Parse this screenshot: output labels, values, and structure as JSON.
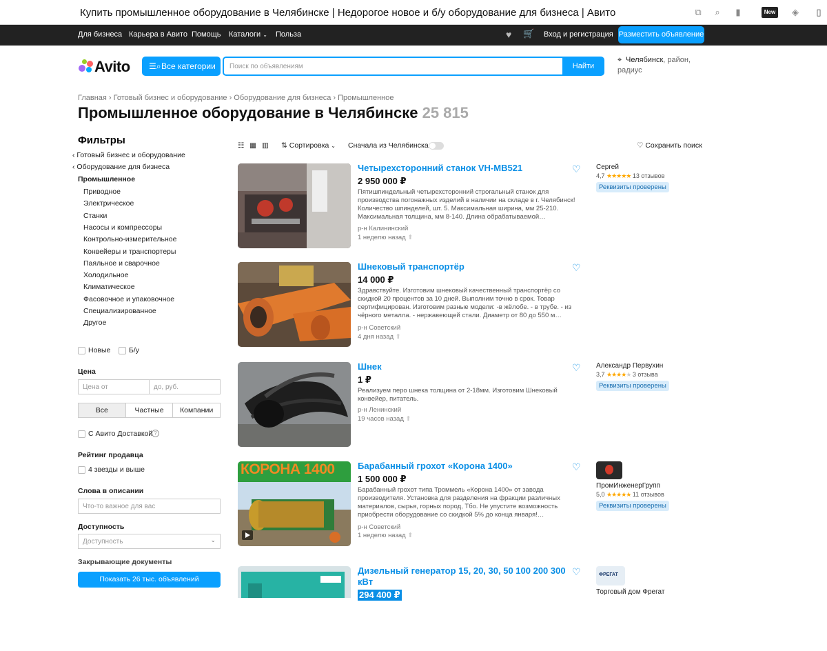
{
  "window": {
    "title": "Купить промышленное оборудование в Челябинске | Недорогое новое и б/у оборудование для бизнеса | Авито",
    "new_badge": "New"
  },
  "topnav": {
    "items": [
      "Для бизнеса",
      "Карьера в Авито",
      "Помощь",
      "Каталоги",
      "Польза"
    ],
    "login": "Вход и регистрация",
    "post": "Разместить объявление"
  },
  "header": {
    "logo": "Avito",
    "categories": "Все категории",
    "search_placeholder": "Поиск по объявлениям",
    "find": "Найти",
    "location_city": "Челябинск",
    "location_rest": ", район, радиус"
  },
  "breadcrumbs": "Главная  ›  Готовый бизнес и оборудование  ›  Оборудование для бизнеса  ›  Промышленное",
  "page": {
    "title": "Промышленное оборудование в Челябинске",
    "count": "25 815"
  },
  "filters": {
    "heading": "Фильтры",
    "back1": "Готовый бизнес и оборудование",
    "back2": "Оборудование для бизнеса",
    "current": "Промышленное",
    "subcats": [
      "Приводное",
      "Электрическое",
      "Станки",
      "Насосы и компрессоры",
      "Контрольно-измерительное",
      "Конвейеры и транспортеры",
      "Паяльное и сварочное",
      "Холодильное",
      "Климатическое",
      "Фасовочное и упаковочное",
      "Специализированное",
      "Другое"
    ],
    "new": "Новые",
    "used": "Б/у",
    "price_label": "Цена",
    "price_from": "Цена от",
    "price_to": "до, руб.",
    "seg": [
      "Все",
      "Частные",
      "Компании"
    ],
    "delivery": "С Авито Доставкой",
    "rating_label": "Рейтинг продавца",
    "rating_opt": "4 звезды и выше",
    "words_label": "Слова в описании",
    "words_ph": "Что-то важное для вас",
    "avail_label": "Доступность",
    "avail_ph": "Доступность",
    "docs_label": "Закрывающие документы",
    "show": "Показать 26 тыс. объявлений"
  },
  "toolbar": {
    "sort": "Сортировка",
    "first": "Сначала из Челябинска",
    "save": "Сохранить поиск"
  },
  "listings": [
    {
      "title": "Четырехсторонний станок VH-MB521",
      "price": "2 950 000 ₽",
      "desc": "Пятишпиндельный четырехсторонний строгальный станок для производства погонажных изделий в наличии на складе в г. Челябинск! Количество шпинделей, шт. 5. Максимальная ширина, мм 25-210. Максимальная толщина, мм 8-140. Длина обрабатываемой…",
      "area": "р-н Калининский",
      "ago": "1 неделю назад",
      "seller": "Сергей",
      "rating": "4,7",
      "stars": "★★★★★",
      "reviews": "13 отзывов",
      "badge": "Реквизиты проверены"
    },
    {
      "title": "Шнековый транспортёр",
      "price": "14 000 ₽",
      "desc": "Здравствуйте. Изготовим шнековый качественный транспортёр со скидкой 20 процентов за 10 дней. Выполним точно в срок. Товар сертифицирован. Изготовим разные модели: -в жёлобе. - в трубе. - из чёрного металла. - нержавеющей стали. Диаметр от 80 до 550 м…",
      "area": "р-н Советский",
      "ago": "4 дня назад"
    },
    {
      "title": "Шнек",
      "price": "1 ₽",
      "desc": "Реализуем перо шнека толщина от 2-18мм. Изготовим Шнековый конвейер, питатель.",
      "area": "р-н Ленинский",
      "ago": "19 часов назад",
      "seller": "Александр Первухин",
      "rating": "3,7",
      "stars": "★★★★",
      "reviews": "3 отзыва",
      "badge": "Реквизиты проверены"
    },
    {
      "title": "Барабанный грохот «Корона 1400»",
      "price": "1 500 000 ₽",
      "desc": "Барабанный грохот типа Троммель «Корона 1400» от завода производителя. Установка для разделения на фракции различных материалов, сырья, горных пород, Тбо. Не упустите возможность приобрести оборудование со скидкой 5% до конца января!…",
      "area": "р-н Советский",
      "ago": "1 неделю назад",
      "thumb_text": "КОРОНА 1400",
      "seller": "ПромИнженерГрупп",
      "rating": "5,0",
      "stars": "★★★★★",
      "reviews": "11 отзывов",
      "badge": "Реквизиты проверены"
    },
    {
      "title": "Дизельный генератор 15, 20, 30, 50 100 200 300 кВт",
      "price": "294 400 ₽",
      "seller": "Торговый дом Фрегат",
      "logo_text": "ФРЕГАТ"
    }
  ]
}
